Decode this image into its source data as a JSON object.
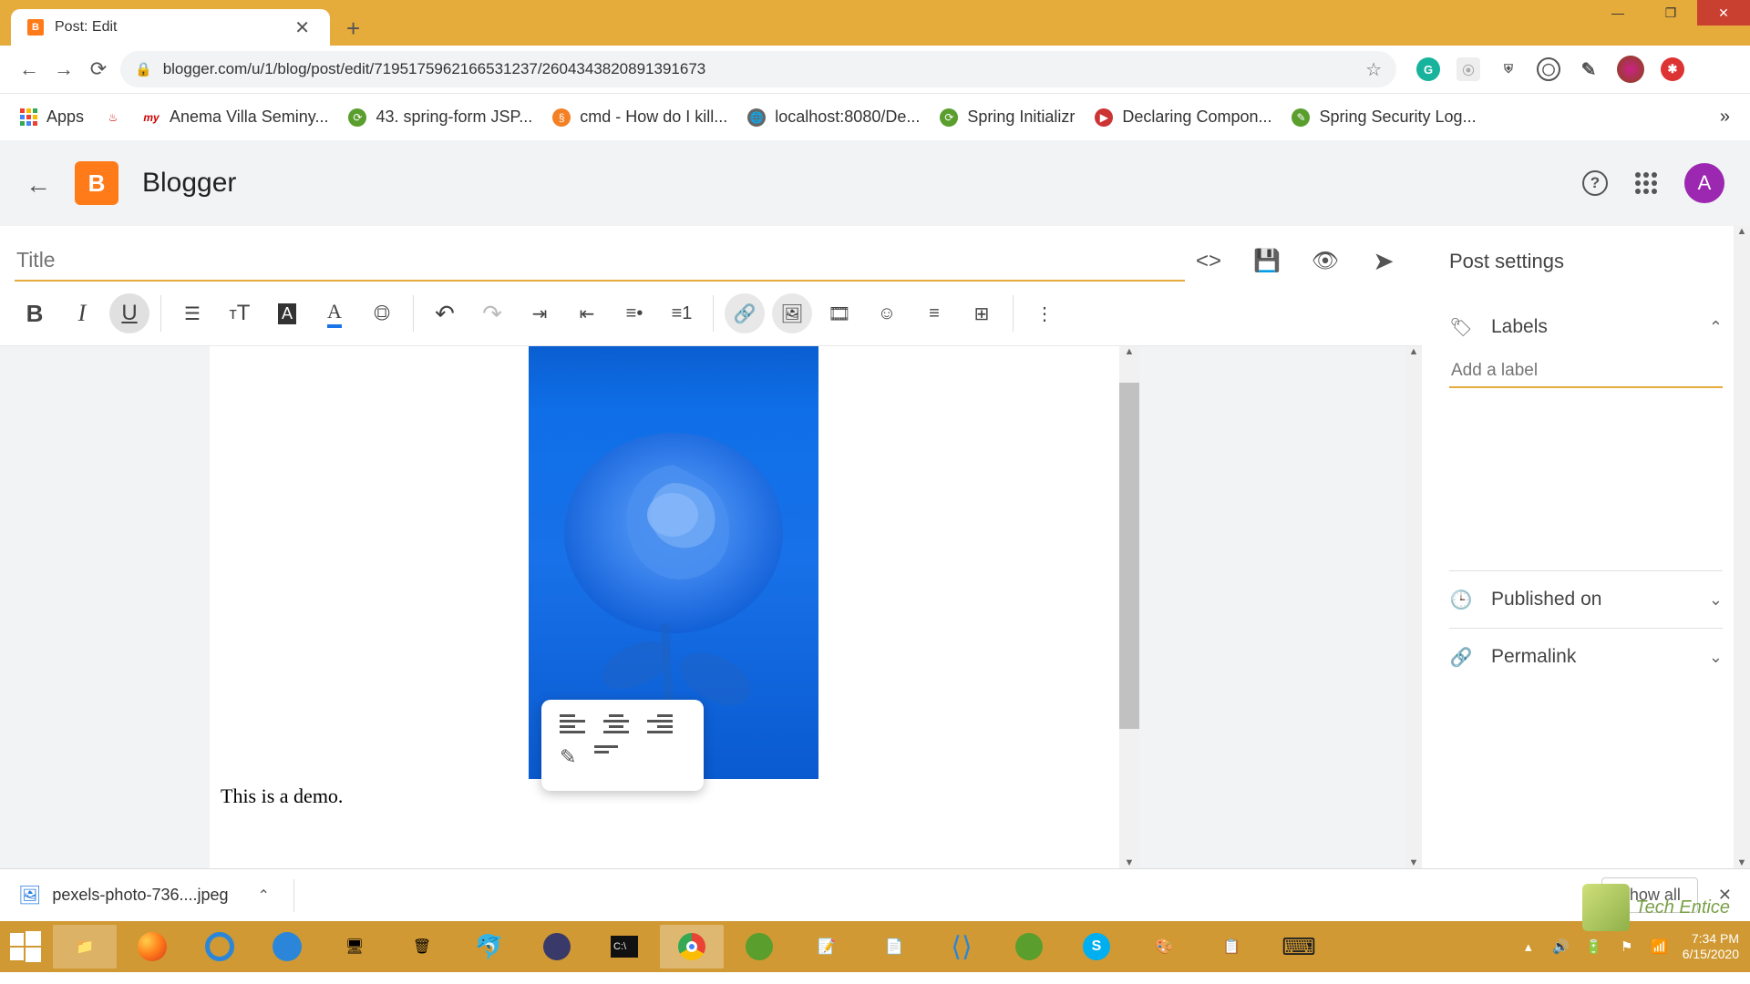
{
  "window": {
    "tab_title": "Post: Edit",
    "url": "blogger.com/u/1/blog/post/edit/7195175962166531237/2604343820891391673"
  },
  "bookmarks": {
    "apps": "Apps",
    "items": [
      "Anema Villa Seminy...",
      "43. spring-form JSP...",
      "cmd - How do I kill...",
      "localhost:8080/De...",
      "Spring Initializr",
      "Declaring Compon...",
      "Spring Security Log..."
    ],
    "overflow": "»"
  },
  "app": {
    "name": "Blogger",
    "avatar_letter": "A"
  },
  "editor": {
    "title_placeholder": "Title",
    "body_text": "This is a demo."
  },
  "sidebar": {
    "heading": "Post settings",
    "labels": {
      "title": "Labels",
      "placeholder": "Add a label"
    },
    "published": "Published on",
    "permalink": "Permalink"
  },
  "downloads": {
    "file": "pexels-photo-736....jpeg",
    "show_all": "Show all"
  },
  "system": {
    "time": "7:34 PM",
    "date": "6/15/2020"
  },
  "watermark": "Tech Entice"
}
